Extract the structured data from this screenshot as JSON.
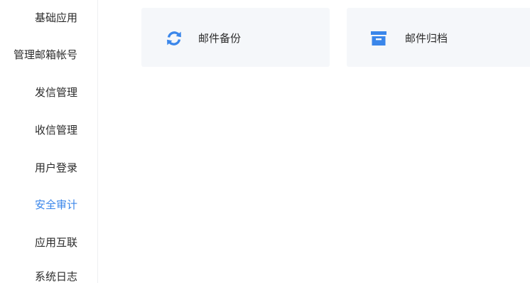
{
  "sidebar": {
    "items": [
      {
        "label": "基础应用"
      },
      {
        "label": "管理邮箱帐号"
      },
      {
        "label": "发信管理"
      },
      {
        "label": "收信管理"
      },
      {
        "label": "用户登录"
      },
      {
        "label": "安全审计",
        "active": true
      },
      {
        "label": "应用互联"
      },
      {
        "label": "系统日志"
      }
    ]
  },
  "cards": [
    {
      "label": "邮件备份",
      "icon": "refresh-icon"
    },
    {
      "label": "邮件归档",
      "icon": "archive-box-icon"
    }
  ],
  "colors": {
    "accent": "#3a86ea",
    "card_background": "#f5f7fa",
    "text": "#2b2b2b"
  }
}
